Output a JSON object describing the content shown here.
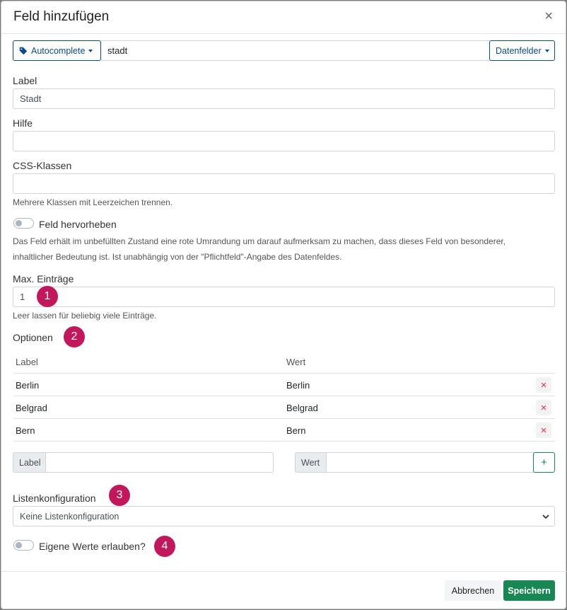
{
  "modal": {
    "title": "Feld hinzufügen",
    "close_glyph": "×"
  },
  "topbar": {
    "type_button": "Autocomplete",
    "name_value": "stadt",
    "datafields_button": "Datenfelder"
  },
  "fields": {
    "label": {
      "label": "Label",
      "value": "Stadt"
    },
    "help": {
      "label": "Hilfe",
      "value": ""
    },
    "css": {
      "label": "CSS-Klassen",
      "value": "",
      "hint": "Mehrere Klassen mit Leerzeichen trennen."
    },
    "highlight": {
      "label": "Feld hervorheben",
      "description_line1": "Das Feld erhält im unbefüllten Zustand eine rote Umrandung um darauf aufmerksam zu machen, dass dieses Feld von besonderer,",
      "description_line2": "inhaltlicher Bedeutung ist. Ist unabhängig von der \"Pflichtfeld\"-Angabe des Datenfeldes.",
      "enabled": false
    },
    "max_entries": {
      "label": "Max. Einträge",
      "value": "1",
      "hint": "Leer lassen für beliebig viele Einträge."
    }
  },
  "options": {
    "title": "Optionen",
    "columns": [
      "Label",
      "Wert"
    ],
    "rows": [
      {
        "label": "Berlin",
        "value": "Berlin"
      },
      {
        "label": "Belgrad",
        "value": "Belgrad"
      },
      {
        "label": "Bern",
        "value": "Bern"
      }
    ],
    "delete_glyph": "×",
    "new_label_addon": "Label",
    "new_value_addon": "Wert",
    "add_glyph": "+"
  },
  "list_config": {
    "label": "Listenkonfiguration",
    "selected": "Keine Listenkonfiguration"
  },
  "own_values": {
    "label": "Eigene Werte erlauben?",
    "enabled": false
  },
  "badges": [
    "1",
    "2",
    "3",
    "4"
  ],
  "footer": {
    "cancel": "Abbrechen",
    "save": "Speichern"
  },
  "colors": {
    "badge": "#c2185b",
    "primary_outline": "#0b4a8a",
    "success": "#198754",
    "danger": "#dc3545"
  },
  "icons": {
    "tag": "tag-icon",
    "close": "close-icon",
    "remove": "remove-icon",
    "add": "plus-icon",
    "chevron": "chevron-down-icon"
  }
}
